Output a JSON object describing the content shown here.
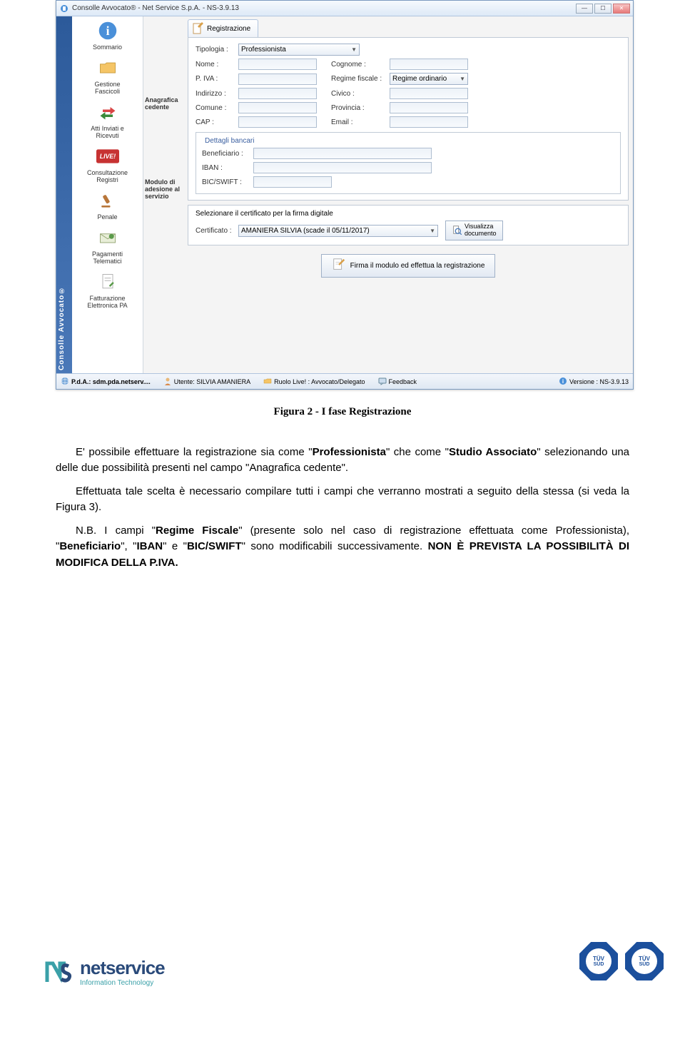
{
  "window": {
    "title": "Consolle Avvocato® - Net Service S.p.A. - NS-3.9.13",
    "leftRail": "Consolle Avvocato®"
  },
  "sidebar": {
    "items": [
      {
        "label": "Sommario"
      },
      {
        "label": "Gestione\nFascicoli"
      },
      {
        "label": "Atti Inviati e\nRicevuti"
      },
      {
        "label": "Consultazione\nRegistri"
      },
      {
        "label": "Penale"
      },
      {
        "label": "Pagamenti\nTelematici"
      },
      {
        "label": "Fatturazione\nElettronica PA"
      }
    ]
  },
  "sections": {
    "anagrafica": "Anagrafica\ncedente",
    "modulo": "Modulo di\nadesione\nal servizio"
  },
  "tab": {
    "label": "Registrazione"
  },
  "form": {
    "tipologia_label": "Tipologia :",
    "tipologia_value": "Professionista",
    "nome_label": "Nome :",
    "cognome_label": "Cognome :",
    "piva_label": "P. IVA :",
    "regime_label": "Regime fiscale :",
    "regime_value": "Regime ordinario",
    "indirizzo_label": "Indirizzo :",
    "civico_label": "Civico :",
    "comune_label": "Comune :",
    "provincia_label": "Provincia :",
    "cap_label": "CAP :",
    "email_label": "Email :",
    "dettagli_bancari": "Dettagli bancari",
    "beneficiario_label": "Beneficiario :",
    "iban_label": "IBAN :",
    "bic_label": "BIC/SWIFT :"
  },
  "cert": {
    "instruction": "Selezionare il certificato per la firma digitale",
    "label": "Certificato :",
    "value": "AMANIERA SILVIA (scade il 05/11/2017)",
    "view_btn_l1": "Visualizza",
    "view_btn_l2": "documento"
  },
  "sign_button": "Firma il modulo ed effettua la registrazione",
  "status": {
    "pda": "P.d.A.: sdm.pda.netserv....",
    "utente": "Utente: SILVIA AMANIERA",
    "ruolo": "Ruolo Live! : Avvocato/Delegato",
    "feedback": "Feedback",
    "versione": "Versione : NS-3.9.13"
  },
  "doc": {
    "caption": "Figura 2 - I fase Registrazione",
    "p1a": "E' possibile effettuare la registrazione sia come \"",
    "p1b": "Professionista",
    "p1c": "\" che come \"",
    "p1d": "Studio Associato",
    "p1e": "\" selezionando una delle due possibilità presenti nel campo \"Anagrafica cedente\".",
    "p2": "Effettuata tale scelta è necessario compilare tutti i campi che verranno mostrati a seguito della stessa (si veda la Figura 3).",
    "p3a": "N.B. I campi \"",
    "p3b": "Regime Fiscale",
    "p3c": "\" (presente solo nel caso di registrazione effettuata come  Professionista), \"",
    "p3d": "Beneficiario",
    "p3e": "\", \"",
    "p3f": "IBAN",
    "p3g": "\" e \"",
    "p3h": "BIC/SWIFT",
    "p3i": "\" sono modificabili successivamente. ",
    "p3j": "NON È PREVISTA LA POSSIBILITÀ DI MODIFICA DELLA P.IVA."
  },
  "footer": {
    "netservice": "netservice",
    "netservice_sub": "Information Technology",
    "tuv": "TÜV",
    "sud": "SÜD"
  }
}
